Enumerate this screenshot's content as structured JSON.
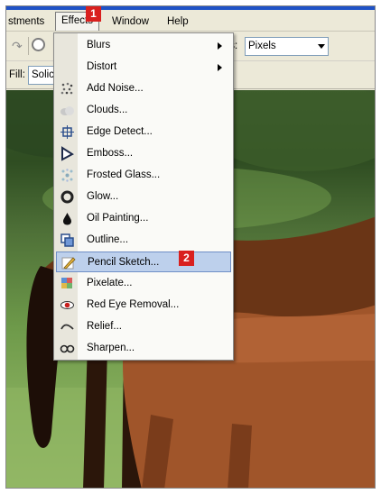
{
  "menubar": {
    "items": [
      {
        "label": "stments",
        "active": false
      },
      {
        "label": "Effects",
        "active": true
      },
      {
        "label": "Window",
        "active": false
      },
      {
        "label": "Help",
        "active": false
      }
    ]
  },
  "toolbar": {
    "units_label": "ts:",
    "units_value": "Pixels"
  },
  "options": {
    "fill_label": "Fill:",
    "fill_value": "Solic"
  },
  "effects_menu": {
    "items": [
      {
        "label": "Blurs",
        "icon": "none",
        "submenu": true
      },
      {
        "label": "Distort",
        "icon": "none",
        "submenu": true
      },
      {
        "label": "Add Noise...",
        "icon": "add-noise-icon"
      },
      {
        "label": "Clouds...",
        "icon": "clouds-icon"
      },
      {
        "label": "Edge Detect...",
        "icon": "edge-detect-icon"
      },
      {
        "label": "Emboss...",
        "icon": "emboss-icon"
      },
      {
        "label": "Frosted Glass...",
        "icon": "frosted-glass-icon"
      },
      {
        "label": "Glow...",
        "icon": "glow-icon"
      },
      {
        "label": "Oil Painting...",
        "icon": "oil-painting-icon"
      },
      {
        "label": "Outline...",
        "icon": "outline-icon"
      },
      {
        "label": "Pencil Sketch...",
        "icon": "pencil-sketch-icon",
        "highlighted": true
      },
      {
        "label": "Pixelate...",
        "icon": "pixelate-icon"
      },
      {
        "label": "Red Eye Removal...",
        "icon": "red-eye-removal-icon"
      },
      {
        "label": "Relief...",
        "icon": "relief-icon"
      },
      {
        "label": "Sharpen...",
        "icon": "sharpen-icon"
      }
    ]
  },
  "callouts": [
    "1",
    "2"
  ],
  "colors": {
    "accent_blue": "#1f52c6",
    "highlight": "#bdd0ec",
    "badge_red": "#d9201e"
  }
}
